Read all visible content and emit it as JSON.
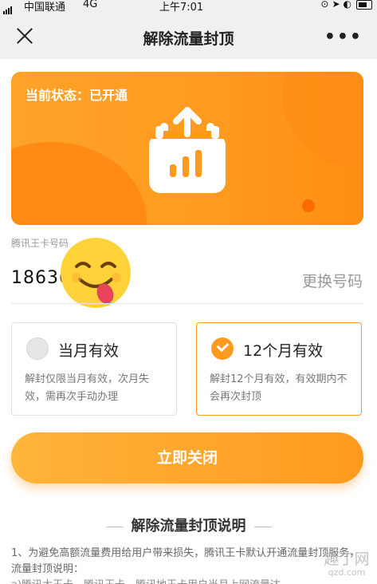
{
  "status_bar": {
    "carrier": "中国联通",
    "network": "4G",
    "time": "上午7:01"
  },
  "nav": {
    "title": "解除流量封顶",
    "close_icon": "close-icon",
    "more_icon": "more-icon"
  },
  "banner": {
    "status": "当前状态：已开通",
    "icon": "upload-calendar-icon",
    "colors": {
      "primary": "#ff9a1f",
      "dark": "#ff8a14",
      "accent_dot": "#ff6a00"
    }
  },
  "phone": {
    "label": "腾讯王卡号码",
    "number": "18636",
    "change_label": "更换号码",
    "sticker": "emoji-face-sticker"
  },
  "options": [
    {
      "name": "当月有效",
      "desc": "解封仅限当月有效，次月失效，需再次手动办理",
      "selected": false
    },
    {
      "name": "12个月有效",
      "desc": "解封12个月有效，有效期内不会再次封顶",
      "selected": true
    }
  ],
  "action": {
    "label": "立即关闭"
  },
  "explanation": {
    "title": "解除流量封顶说明",
    "para1": "1、为避免高额流量费用给用户带来损失，腾讯王卡默认开通流量封顶服务，流量封顶说明：",
    "para2": "a)腾讯大王卡、腾讯王卡、腾讯地王卡用户当月上网流量达"
  },
  "watermark": {
    "name": "趣丁网",
    "site": "qzd.com"
  }
}
